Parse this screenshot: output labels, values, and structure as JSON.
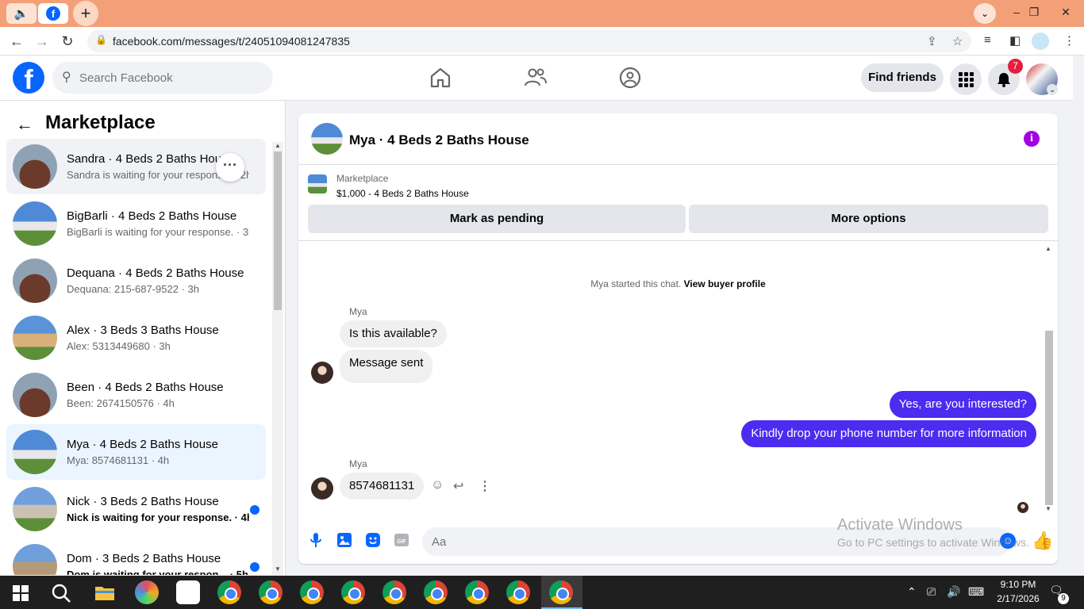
{
  "browser": {
    "url": "facebook.com/messages/t/24051094081247835",
    "window_controls": [
      "–",
      "❐",
      "✕"
    ]
  },
  "facebook": {
    "search_placeholder": "Search Facebook",
    "find_friends": "Find friends",
    "notification_count": "7"
  },
  "sidebar": {
    "title": "Marketplace",
    "conversations": [
      {
        "title": "Sandra · 4 Beds 2 Baths House",
        "subtitle": "Sandra is waiting for your response. · 2h",
        "unread": false
      },
      {
        "title": "BigBarli · 4 Beds 2 Baths House",
        "subtitle": "BigBarli is waiting for your response. · 3h",
        "unread": false
      },
      {
        "title": "Dequana · 4 Beds 2 Baths House",
        "subtitle": "Dequana: 215-687-9522 · 3h",
        "unread": false
      },
      {
        "title": "Alex · 3 Beds 3 Baths House",
        "subtitle": "Alex: 5313449680 · 3h",
        "unread": false
      },
      {
        "title": "Been · 4 Beds 2 Baths House",
        "subtitle": "Been: 2674150576 · 4h",
        "unread": false
      },
      {
        "title": "Mya · 4 Beds 2 Baths House",
        "subtitle": "Mya: 8574681131 · 4h",
        "unread": false
      },
      {
        "title": "Nick · 3 Beds 2 Baths House",
        "subtitle": "Nick is waiting for your response. · 4h",
        "unread": true
      },
      {
        "title": "Dom · 3 Beds 2 Baths House",
        "subtitle": "Dom is waiting for your respon... · 5h",
        "unread": true
      }
    ]
  },
  "chat": {
    "title": "Mya · 4 Beds 2 Baths House",
    "listing_label": "Marketplace",
    "listing_desc": "$1,000 - 4 Beds 2 Baths House",
    "mark_pending": "Mark as pending",
    "more_options": "More options",
    "started_text": "Mya started this chat.",
    "view_buyer": "View buyer profile",
    "sender_name": "Mya",
    "messages": [
      {
        "text": "Is this available?"
      },
      {
        "text": "Message sent"
      },
      {
        "text": "Yes, are you interested?"
      },
      {
        "text": "Kindly drop your phone number for more information"
      },
      {
        "text": "8574681131"
      }
    ],
    "composer_placeholder": "Aa"
  },
  "watermark": {
    "line1": "Activate Windows",
    "line2": "Go to PC settings to activate Windows."
  },
  "taskbar": {
    "time": "9:10 PM",
    "date": "2/17/2026",
    "notifications": "9"
  }
}
